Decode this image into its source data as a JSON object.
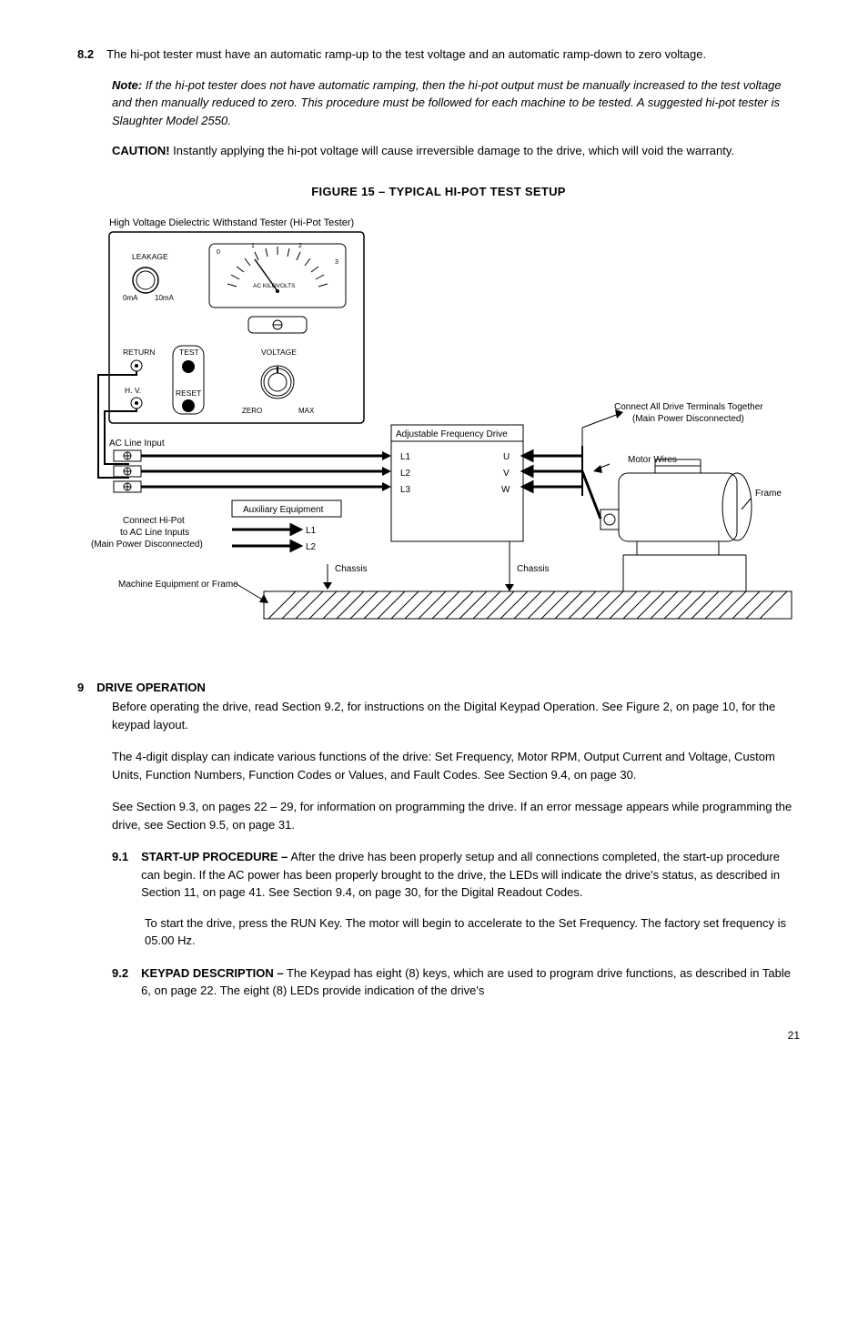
{
  "sec82": {
    "num": "8.2",
    "body": "The hi-pot tester must have an automatic ramp-up to the test voltage and an automatic ramp-down to zero voltage.",
    "noteLabel": "Note:",
    "noteBody": "If the hi-pot tester does not have automatic ramping, then the hi-pot output must be manually increased to the test voltage and then manually reduced to zero. This procedure must be followed for each machine to be tested. A suggested hi-pot tester is Slaughter Model 2550.",
    "cautionLabel": "CAUTION!",
    "cautionBody": "Instantly applying the hi-pot voltage will cause irreversible damage to the drive, which will void the warranty."
  },
  "figTitle": "FIGURE 15 – TYPICAL HI-POT TEST SETUP",
  "fig": {
    "hdr": "High Voltage Dielectric Withstand Tester (Hi-Pot Tester)",
    "leakage": "LEAKAGE",
    "zeroMa": "0mA",
    "tenMa": "10mA",
    "acKv": "AC KILOVOLTS",
    "d0": "0",
    "d1": "1",
    "d2": "2",
    "d3": "3",
    "return": "RETURN",
    "test": "TEST",
    "voltage": "VOLTAGE",
    "hv": "H. V.",
    "reset": "RESET",
    "zero": "ZERO",
    "max": "MAX",
    "acLine": "AC Line Input",
    "aux": "Auxiliary Equipment",
    "auxL1": "L1",
    "auxL2": "L2",
    "chassis": "Chassis",
    "connHi1": "Connect Hi-Pot",
    "connHi2": "to AC Line Inputs",
    "connHi3": "(Main Power Disconnected)",
    "meqFrame": "Machine Equipment or Frame",
    "afd": "Adjustable Frequency Drive",
    "driveL1": "L1",
    "driveL2": "L2",
    "driveL3": "L3",
    "driveU": "U",
    "driveV": "V",
    "driveW": "W",
    "connAll1": "Connect All Drive Terminals Together",
    "connAll2": "(Main Power Disconnected)",
    "motorWires": "Motor Wires",
    "frame": "Frame"
  },
  "sec9": {
    "num": "9",
    "title": "DRIVE OPERATION",
    "p1": "Before operating the drive, read Section 9.2, for instructions on the Digital Keypad Operation. See Figure 2, on page 10, for the keypad layout.",
    "p2": "The 4-digit display can indicate various functions of the drive: Set Frequency, Motor RPM, Output Current and Voltage, Custom Units, Function Numbers, Function Codes or Values, and Fault Codes. See Section 9.4, on page 30.",
    "p3": "See Section 9.3, on pages 22 – 29, for information on programming the drive. If an error message appears while programming the drive, see Section 9.5, on page 31."
  },
  "sec91": {
    "num": "9.1",
    "title": "START-UP PROCEDURE –",
    "body": "After the drive has been properly setup and all connections completed, the start-up procedure can begin. If the AC power has been properly brought to the drive, the LEDs will indicate the drive's status, as described in Section 11, on page 41. See Section 9.4, on page 30, for the Digital Readout Codes.",
    "p2": "To start the drive, press the RUN Key. The motor will begin to accelerate to the Set Frequency. The factory set frequency is 05.00 Hz."
  },
  "sec92": {
    "num": "9.2",
    "title": "KEYPAD DESCRIPTION –",
    "body": "The Keypad has eight (8) keys, which are used to program drive functions, as described in Table 6, on page 22. The eight (8) LEDs provide indication of the drive's"
  },
  "pageNum": "21"
}
